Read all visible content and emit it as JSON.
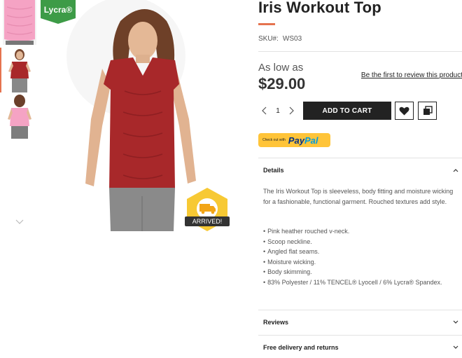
{
  "gallery": {
    "badge": "Lycra®",
    "arrived_badge": "ARRIVED!",
    "thumbnails": [
      "thumbnail-pink-top-detail",
      "thumbnail-red-top",
      "thumbnail-pink-top-back"
    ],
    "colors": {
      "red_top": "#a8282a",
      "pink_top": "#f5a3c4",
      "badge_green": "#3d9b47",
      "badge_yellow": "#f7c934"
    }
  },
  "product": {
    "title": "Iris Workout Top",
    "sku_label": "SKU#:",
    "sku_value": "WS03",
    "price_prefix": "As low as",
    "price": "$29.00",
    "review_link": "Be the first to review this product",
    "qty": "1",
    "add_to_cart": "ADD TO CART",
    "paypal_small": "Check out with",
    "paypal_brand_1": "Pay",
    "paypal_brand_2": "Pal"
  },
  "accordion": {
    "details": {
      "title": "Details",
      "description": "The Iris Workout Top is sleeveless, body fitting and moisture wicking for a fashionable, functional garment. Rouched textures add style.",
      "features": [
        "Pink heather rouched v-neck.",
        "Scoop neckline.",
        "Angled flat seams.",
        "Moisture wicking.",
        "Body skimming.",
        "83% Polyester / 11% TENCEL® Lyocell / 6% Lycra® Spandex."
      ]
    },
    "reviews": {
      "title": "Reviews"
    },
    "delivery": {
      "title": "Free delivery and returns"
    }
  },
  "theme": {
    "accent": "#e5734f",
    "dark": "#222222"
  }
}
